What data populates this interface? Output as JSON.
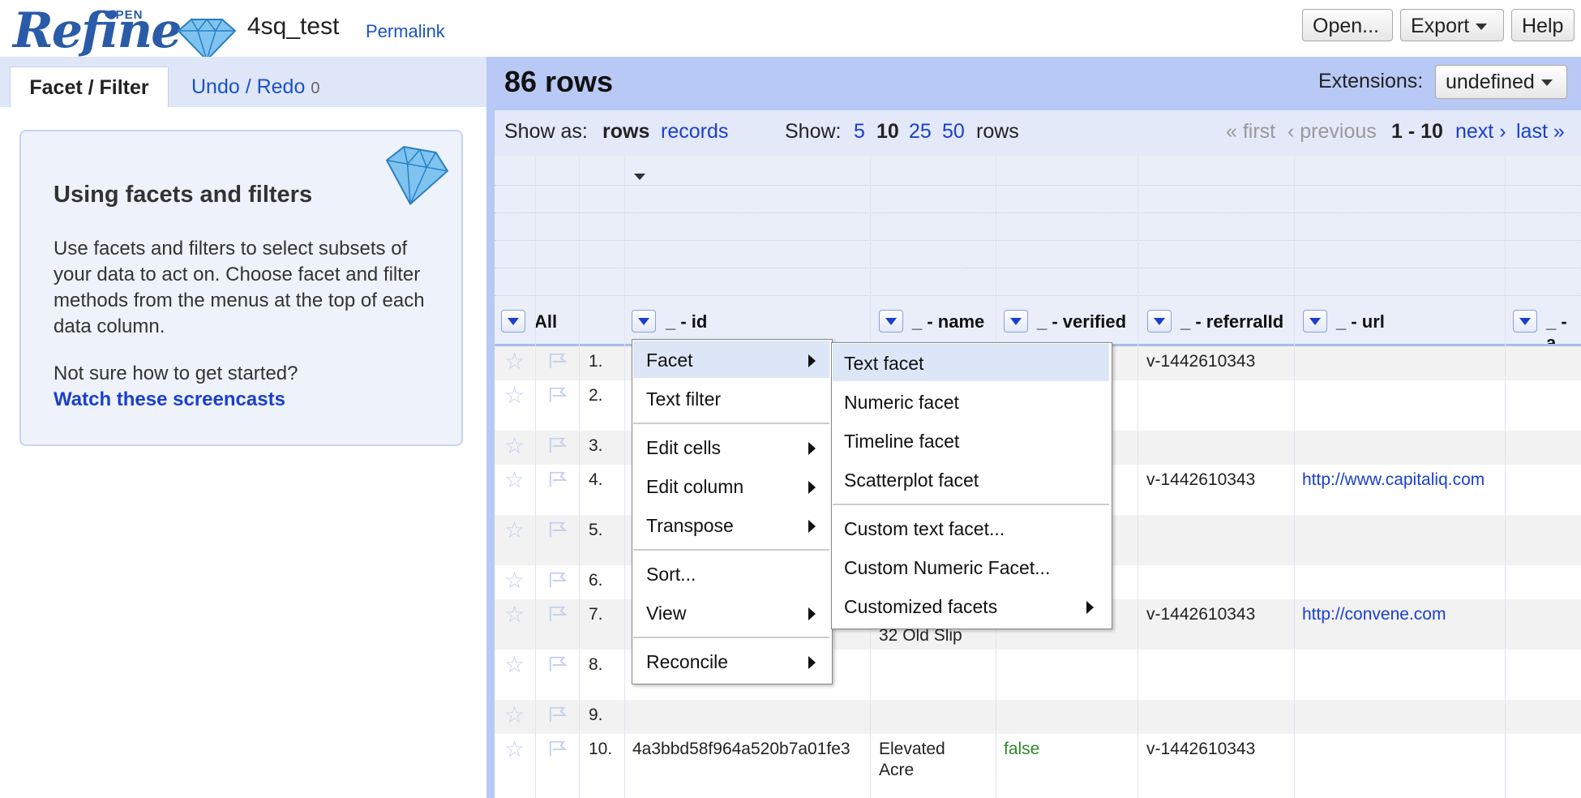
{
  "header": {
    "logo_text": "Refine",
    "logo_badge": "OPEN",
    "project_name": "4sq_test",
    "permalink": "Permalink",
    "buttons": {
      "open": "Open...",
      "export": "Export",
      "help": "Help"
    }
  },
  "left": {
    "tabs": {
      "facet_filter": "Facet / Filter",
      "undo_redo": "Undo / Redo",
      "undo_count": "0"
    },
    "help": {
      "title": "Using facets and filters",
      "body": "Use facets and filters to select subsets of your data to act on. Choose facet and filter methods from the menus at the top of each data column.",
      "question": "Not sure how to get started?",
      "link": "Watch these screencasts"
    }
  },
  "right": {
    "rows_count": "86 rows",
    "extensions_label": "Extensions:",
    "extensions_value": "undefined",
    "show_as_label": "Show as:",
    "show_as_rows": "rows",
    "show_as_records": "records",
    "show_label": "Show:",
    "page_sizes": [
      "5",
      "10",
      "25",
      "50"
    ],
    "rows_word": "rows",
    "pager": {
      "first": "« first",
      "previous": "‹ previous",
      "range": "1 - 10",
      "next": "next ›",
      "last": "last »"
    }
  },
  "columns": [
    "All",
    "_ - id",
    "_ - name",
    "_ - verified",
    "_ - referralId",
    "_ - url",
    "_ - a"
  ],
  "rows": [
    {
      "num": "1.",
      "id": "",
      "name": "",
      "verified": "",
      "referralId": "v-1442610343",
      "url": ""
    },
    {
      "num": "2.",
      "id": "",
      "name": "",
      "verified": "",
      "referralId": "",
      "url": ""
    },
    {
      "num": "3.",
      "id": "",
      "name": "",
      "verified": "",
      "referralId": "",
      "url": ""
    },
    {
      "num": "4.",
      "id": "",
      "name": "",
      "verified": "",
      "referralId": "v-1442610343",
      "url": "http://www.capitaliq.com"
    },
    {
      "num": "5.",
      "id": "",
      "name": "",
      "verified": "",
      "referralId": "",
      "url": ""
    },
    {
      "num": "6.",
      "id": "",
      "name": "",
      "verified": "",
      "referralId": "",
      "url": ""
    },
    {
      "num": "7.",
      "id": "",
      "name": "32 Old Slip",
      "verified": "",
      "referralId": "v-1442610343",
      "url": "http://convene.com"
    },
    {
      "num": "8.",
      "id": "",
      "name": "",
      "verified": "",
      "referralId": "",
      "url": ""
    },
    {
      "num": "9.",
      "id": "",
      "name": "",
      "verified": "",
      "referralId": "",
      "url": ""
    },
    {
      "num": "10.",
      "id": "4a3bbd58f964a520b7a01fe3",
      "name_line1": "Elevated",
      "name_line2": "Acre",
      "verified": "false",
      "referralId": "v-1442610343",
      "url": ""
    }
  ],
  "column_menu": {
    "items": [
      "Facet",
      "Text filter",
      "Edit cells",
      "Edit column",
      "Transpose",
      "Sort...",
      "View",
      "Reconcile"
    ]
  },
  "facet_submenu": {
    "items": [
      "Text facet",
      "Numeric facet",
      "Timeline facet",
      "Scatterplot facet",
      "Custom text facet...",
      "Custom Numeric Facet...",
      "Customized facets"
    ]
  },
  "colors": {
    "header_blue": "#b8c9f5",
    "link": "#1a3fcf",
    "highlight": "#dce6f6"
  }
}
